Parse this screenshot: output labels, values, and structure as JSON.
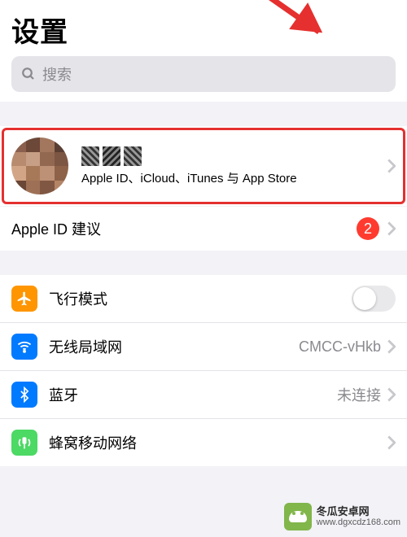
{
  "header": {
    "title": "设置"
  },
  "search": {
    "placeholder": "搜索"
  },
  "profile": {
    "name": "███",
    "subtitle": "Apple ID、iCloud、iTunes 与 App Store"
  },
  "suggestions": {
    "label": "Apple ID 建议",
    "badge_count": "2"
  },
  "rows": {
    "airplane": {
      "label": "飞行模式",
      "icon_color": "#ff9500"
    },
    "wifi": {
      "label": "无线局域网",
      "value": "CMCC-vHkb",
      "icon_color": "#007aff"
    },
    "bluetooth": {
      "label": "蓝牙",
      "value": "未连接",
      "icon_color": "#007aff"
    },
    "cellular": {
      "label": "蜂窝移动网络",
      "icon_color": "#4cd964"
    }
  },
  "watermark": {
    "line1": "冬瓜安卓网",
    "line2": "www.dgxcdz168.com"
  }
}
